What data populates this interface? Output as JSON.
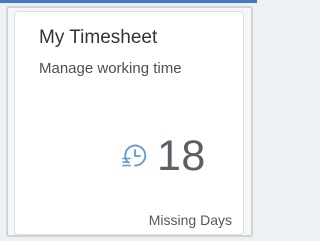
{
  "tile": {
    "title": "My Timesheet",
    "subtitle": "Manage working time",
    "kpi_value": "18",
    "footer": "Missing Days",
    "icon": "timesheet-clock-icon"
  },
  "colors": {
    "accent": "#5a9bd5",
    "text": "#32363a",
    "kpi": "#5a6067",
    "top_bar": "#4a78b8"
  }
}
